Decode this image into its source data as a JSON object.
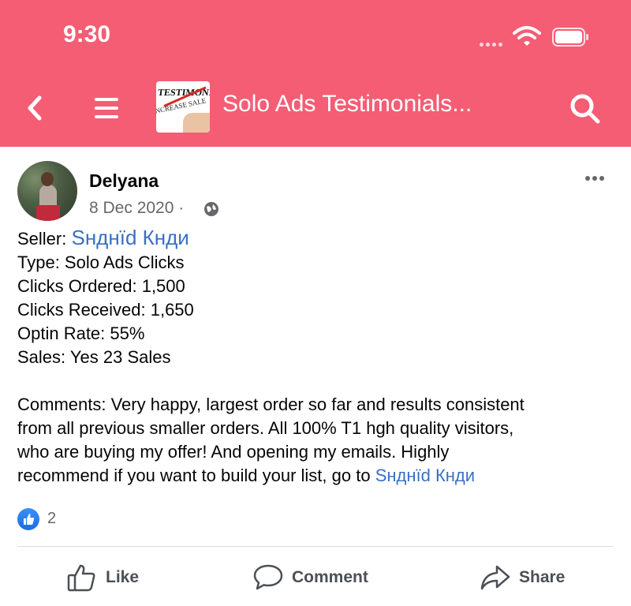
{
  "status_bar": {
    "time": "9:30"
  },
  "header": {
    "title": "Solo Ads Testimonials...",
    "thumb_line1": "TESTIMONIAL",
    "thumb_line2": "NCREASE SALE"
  },
  "post": {
    "author": "Delyana",
    "date": "8 Dec 2020 ·",
    "seller_label": "Seller:",
    "seller_name": "Sнднїd Кнди",
    "lines": [
      "Type: Solo Ads Clicks",
      "Clicks Ordered: 1,500",
      "Clicks Received: 1,650",
      "Optin Rate: 55%",
      "Sales: Yes 23 Sales"
    ],
    "comments": [
      "Comments: Very happy, largest order so far and results consistent",
      "from all previous smaller orders. All 100% T1 hgh quality visitors,",
      "who are buying my offer! And opening my emails. Highly",
      "recommend if you want to build your list, go to"
    ],
    "comments_link": "Sнднїd Кнди",
    "reaction_count": "2"
  },
  "actions": {
    "like": "Like",
    "comment": "Comment",
    "share": "Share"
  },
  "colors": {
    "header_bg": "#f45d74",
    "link": "#3a6fc4",
    "like_blue": "#1a6ee8"
  }
}
